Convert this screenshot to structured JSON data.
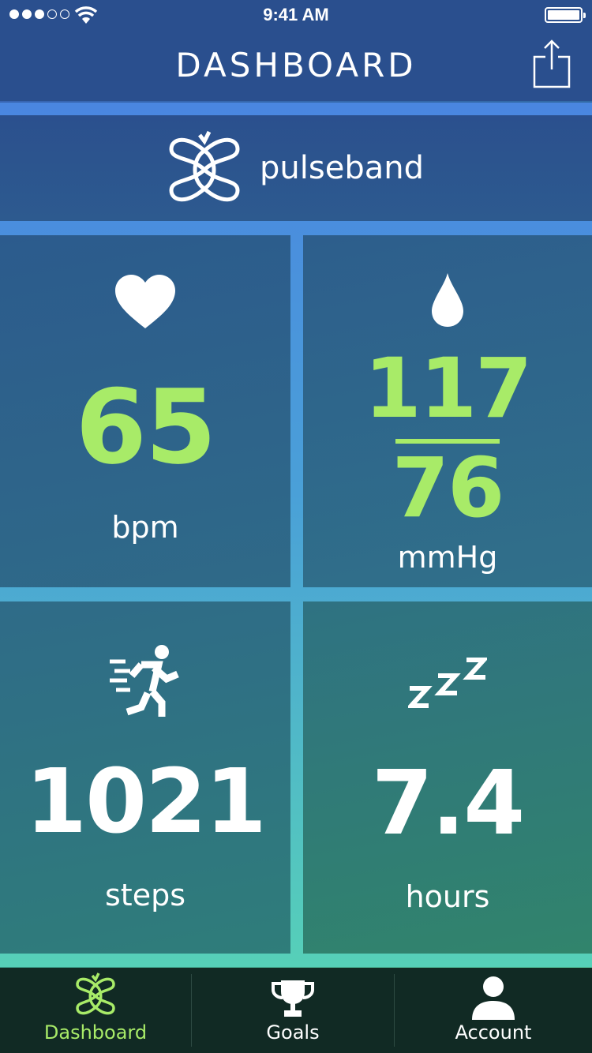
{
  "status_bar": {
    "time": "9:41 AM",
    "signal_bars_filled": 3,
    "signal_bars_total": 5,
    "battery_level": 1.0
  },
  "header": {
    "title": "DASHBOARD",
    "share_icon": "share-icon"
  },
  "brand": {
    "name": "pulseband",
    "logo_icon": "pulseband-logo-icon"
  },
  "tiles": {
    "heart_rate": {
      "icon": "heart-icon",
      "value": "65",
      "unit": "bpm"
    },
    "blood_pressure": {
      "icon": "drop-icon",
      "systolic": "117",
      "diastolic": "76",
      "unit": "mmHg"
    },
    "steps": {
      "icon": "running-icon",
      "value": "1021",
      "unit": "steps"
    },
    "sleep": {
      "icon": "sleep-icon",
      "value": "7.4",
      "unit": "hours"
    }
  },
  "tab_bar": {
    "items": [
      {
        "label": "Dashboard",
        "icon": "pulseband-logo-icon",
        "active": true
      },
      {
        "label": "Goals",
        "icon": "trophy-icon",
        "active": false
      },
      {
        "label": "Account",
        "icon": "user-icon",
        "active": false
      }
    ]
  },
  "colors": {
    "accent_green": "#a8eb68",
    "header_bg": "#2a4f8e",
    "tabbar_bg": "#112a24"
  }
}
